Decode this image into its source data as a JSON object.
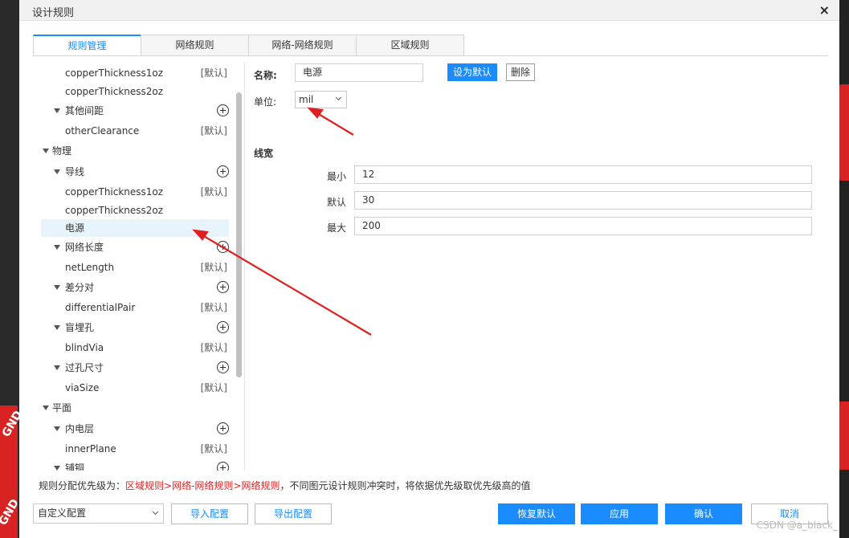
{
  "dialog": {
    "title": "设计规则",
    "close": "×"
  },
  "tabs": [
    {
      "label": "规则管理",
      "active": true
    },
    {
      "label": "网络规则",
      "active": false
    },
    {
      "label": "网络-网络规则",
      "active": false
    },
    {
      "label": "区域规则",
      "active": false
    }
  ],
  "tree": {
    "rows": [
      {
        "label": "copperThickness1oz",
        "tag": "[默认]"
      },
      {
        "label": "copperThickness2oz",
        "tag": ""
      },
      {
        "label": "其他间距"
      },
      {
        "label": "otherClearance",
        "tag": "[默认]"
      },
      {
        "label": "物理"
      },
      {
        "label": "导线"
      },
      {
        "label": "copperThickness1oz",
        "tag": "[默认]"
      },
      {
        "label": "copperThickness2oz",
        "tag": ""
      },
      {
        "label": "电源",
        "selected": true
      },
      {
        "label": "网络长度"
      },
      {
        "label": "netLength",
        "tag": "[默认]"
      },
      {
        "label": "差分对"
      },
      {
        "label": "differentialPair",
        "tag": "[默认]"
      },
      {
        "label": "盲埋孔"
      },
      {
        "label": "blindVia",
        "tag": "[默认]"
      },
      {
        "label": "过孔尺寸"
      },
      {
        "label": "viaSize",
        "tag": "[默认]"
      },
      {
        "label": "平面"
      },
      {
        "label": "内电层"
      },
      {
        "label": "innerPlane",
        "tag": "[默认]"
      },
      {
        "label": "铺铜"
      }
    ]
  },
  "form": {
    "name_label": "名称:",
    "name_value": "电源",
    "set_default": "设为默认",
    "delete": "删除",
    "unit_label": "单位:",
    "unit_value": "mil",
    "section_title": "线宽",
    "min_label": "最小",
    "min_value": "12",
    "default_label": "默认",
    "default_value": "30",
    "max_label": "最大",
    "max_value": "200"
  },
  "footer": {
    "priority_prefix": "规则分配优先级为：",
    "priority_chain": "区域规则>网络-网络规则>网络规则",
    "priority_suffix": "，不同图元设计规则冲突时，将依据优先级取优先级高的值",
    "config_select": "自定义配置",
    "import": "导入配置",
    "export": "导出配置",
    "restore": "恢复默认",
    "apply": "应用",
    "confirm": "确认",
    "cancel": "取消"
  },
  "background": {
    "gnd_left": "GND",
    "gnd_left2": "GND"
  },
  "watermark": "CSDN @a_black_",
  "colors": {
    "accent": "#1a8cff",
    "annotation": "#e02020"
  }
}
